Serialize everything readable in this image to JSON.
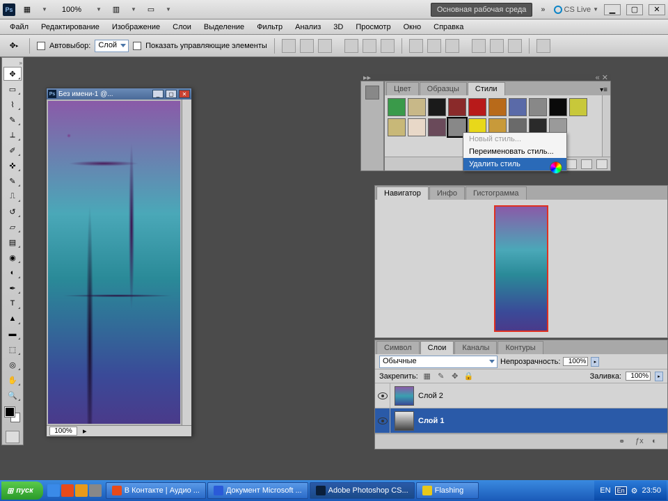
{
  "titlebar": {
    "zoom": "100%",
    "workspace_label": "Основная рабочая среда",
    "cslive": "CS Live"
  },
  "menu": [
    "Файл",
    "Редактирование",
    "Изображение",
    "Слои",
    "Выделение",
    "Фильтр",
    "Анализ",
    "3D",
    "Просмотр",
    "Окно",
    "Справка"
  ],
  "options": {
    "auto_select_label": "Автовыбор:",
    "auto_select_value": "Слой",
    "show_controls_label": "Показать управляющие элементы"
  },
  "document": {
    "title": "Без имени-1 @...",
    "zoom_status": "100%"
  },
  "styles_panel": {
    "tabs": [
      "Цвет",
      "Образцы",
      "Стили"
    ],
    "active_tab": 2,
    "swatch_colors": [
      "#3a9a4a",
      "#c8b888",
      "#1a1a1a",
      "#8a2a2a",
      "#b81a1a",
      "#b86a1a",
      "#5a6aa8",
      "#888",
      "#0a0a0a",
      "#c8c83a",
      "#c8b878",
      "#e8d8c8",
      "#6a4a5a",
      "#888888",
      "#e8d81a",
      "#c89a3a",
      "#6a6a6a",
      "#2a2a2a",
      "#9a9a9a"
    ],
    "selected_index": 13
  },
  "context_menu": {
    "items": [
      {
        "label": "Новый стиль...",
        "disabled": true
      },
      {
        "label": "Переименовать стиль...",
        "disabled": false
      },
      {
        "label": "Удалить стиль",
        "disabled": false,
        "highlight": true
      }
    ]
  },
  "navigator_panel": {
    "tabs": [
      "Навигатор",
      "Инфо",
      "Гистограмма"
    ],
    "active_tab": 0
  },
  "layers_panel": {
    "tabs": [
      "Символ",
      "Слои",
      "Каналы",
      "Контуры"
    ],
    "active_tab": 1,
    "blend_mode": "Обычные",
    "opacity_label": "Непрозрачность:",
    "opacity_value": "100%",
    "lock_label": "Закрепить:",
    "fill_label": "Заливка:",
    "fill_value": "100%",
    "layers": [
      {
        "name": "Слой 2",
        "selected": false
      },
      {
        "name": "Слой 1",
        "selected": true
      }
    ]
  },
  "taskbar": {
    "start": "пуск",
    "buttons": [
      {
        "label": "В Контакте | Аудио ..."
      },
      {
        "label": "Документ Microsoft ..."
      },
      {
        "label": "Adobe Photoshop CS...",
        "active": true
      },
      {
        "label": "Flashing"
      }
    ],
    "lang": "EN",
    "kb": "En",
    "time": "23:50"
  }
}
